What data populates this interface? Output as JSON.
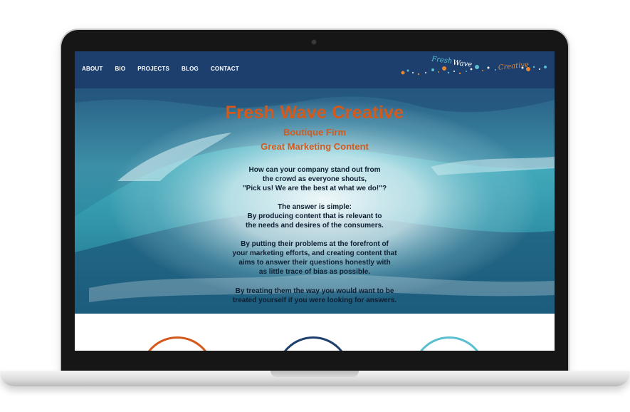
{
  "nav": {
    "items": [
      "ABOUT",
      "BIO",
      "PROJECTS",
      "BLOG",
      "CONTACT"
    ]
  },
  "logo": {
    "word1": "Fresh",
    "word2": "Wave",
    "word3": "Creative",
    "colors": {
      "fresh": "#5bbfcf",
      "wave": "#ffffff",
      "creative": "#e8862e"
    }
  },
  "hero": {
    "title": "Fresh Wave Creative",
    "subtitle1": "Boutique Firm",
    "subtitle2": "Great Marketing Content",
    "paragraphs": [
      [
        "How can your company stand out from",
        "the crowd as everyone shouts,",
        "\"Pick us!  We are the best at what we do!\"?"
      ],
      [
        "The answer is simple:",
        "By producing content that is relevant to",
        "the needs and desires of the consumers."
      ],
      [
        "By putting their problems at the forefront of",
        "your marketing efforts, and creating content that",
        "aims to answer their questions honestly with",
        "as little trace of bias as possible."
      ],
      [
        "By treating them the way you would want to be",
        "treated yourself if you were looking for answers."
      ]
    ]
  },
  "colors": {
    "header_bg": "#1c3f6e",
    "accent": "#d35a1c",
    "circle_orange": "#d35a1c",
    "circle_navy": "#1c3f6e",
    "circle_teal": "#5bbfcf"
  },
  "circles": [
    "orange",
    "navy",
    "teal"
  ]
}
